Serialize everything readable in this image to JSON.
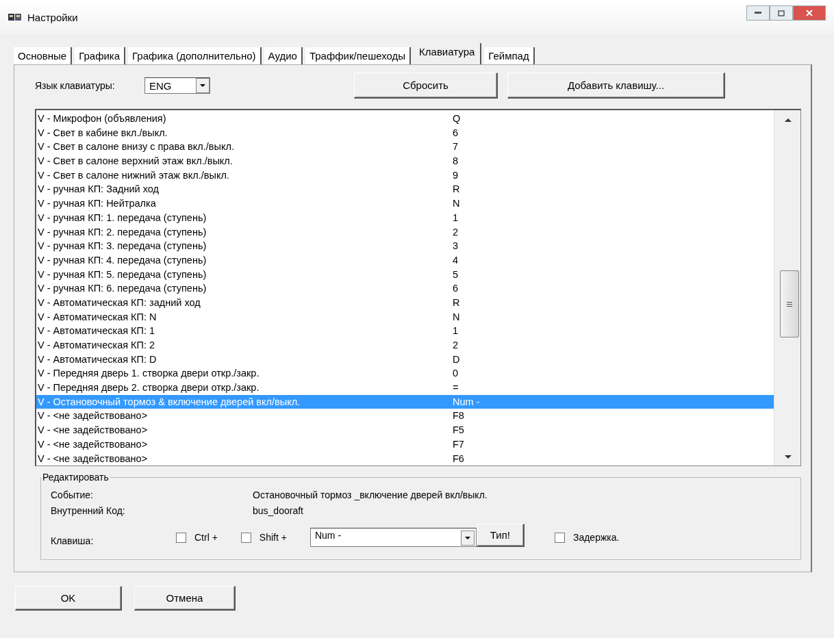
{
  "window": {
    "title": "Настройки"
  },
  "tabs": [
    {
      "label": "Основные",
      "selected": false
    },
    {
      "label": "Графика",
      "selected": false
    },
    {
      "label": "Графика (дополнительно)",
      "selected": false
    },
    {
      "label": "Аудио",
      "selected": false
    },
    {
      "label": "Траффик/пешеходы",
      "selected": false
    },
    {
      "label": "Клавиатура",
      "selected": true
    },
    {
      "label": "Геймпад",
      "selected": false
    }
  ],
  "keyboard_language": {
    "label": "Язык клавиатуры:",
    "value": "ENG"
  },
  "top_buttons": [
    "Сбросить",
    "Добавить клавишу..."
  ],
  "bindings": [
    {
      "action": "V - Микрофон (объявления)",
      "key": "Q",
      "selected": false
    },
    {
      "action": "V - Свет в кабине вкл./выкл.",
      "key": "6",
      "selected": false
    },
    {
      "action": "V - Свет в салоне внизу с права вкл./выкл.",
      "key": "7",
      "selected": false
    },
    {
      "action": "V - Свет в салоне верхний этаж вкл./выкл.",
      "key": "8",
      "selected": false
    },
    {
      "action": "V - Свет в салоне нижний этаж вкл./выкл.",
      "key": "9",
      "selected": false
    },
    {
      "action": "V - ручная КП: Задний ход",
      "key": "R",
      "selected": false
    },
    {
      "action": "V - ручная КП: Нейтралка",
      "key": "N",
      "selected": false
    },
    {
      "action": "V - ручная КП: 1. передача (ступень)",
      "key": "1",
      "selected": false
    },
    {
      "action": "V - ручная КП: 2. передача (ступень)",
      "key": "2",
      "selected": false
    },
    {
      "action": "V - ручная КП: 3. передача (ступень)",
      "key": "3",
      "selected": false
    },
    {
      "action": "V - ручная КП: 4. передача (ступень)",
      "key": "4",
      "selected": false
    },
    {
      "action": "V - ручная КП: 5. передача (ступень)",
      "key": "5",
      "selected": false
    },
    {
      "action": "V - ручная КП: 6. передача (ступень)",
      "key": "6",
      "selected": false
    },
    {
      "action": "V - Автоматическая КП: задний ход",
      "key": "R",
      "selected": false
    },
    {
      "action": "V - Автоматическая КП: N",
      "key": "N",
      "selected": false
    },
    {
      "action": "V - Автоматическая КП: 1",
      "key": "1",
      "selected": false
    },
    {
      "action": "V - Автоматическая КП: 2",
      "key": "2",
      "selected": false
    },
    {
      "action": "V - Автоматическая КП: D",
      "key": "D",
      "selected": false
    },
    {
      "action": "V - Передняя дверь 1. створка двери откр./закр.",
      "key": "0",
      "selected": false
    },
    {
      "action": "V - Передняя дверь 2. створка двери откр./закр.",
      "key": "=",
      "selected": false
    },
    {
      "action": "V - Остановочный тормоз & включение дверей вкл/выкл.",
      "key": "Num -",
      "selected": true
    },
    {
      "action": "V - <не задействовано>",
      "key": "F8",
      "selected": false
    },
    {
      "action": "V - <не задействовано>",
      "key": "F5",
      "selected": false
    },
    {
      "action": "V - <не задействовано>",
      "key": "F7",
      "selected": false
    },
    {
      "action": "V - <не задействовано>",
      "key": "F6",
      "selected": false
    }
  ],
  "edit": {
    "title": "Редактировать",
    "event_label": "Событие:",
    "event_value": "Остановочный тормоз _включение дверей вкл/выкл.",
    "code_label": "Внутренний Код:",
    "code_value": "bus_dooraft",
    "key_label": "Клавиша:",
    "ctrl": {
      "label": "Ctrl +",
      "checked": false
    },
    "shift": {
      "label": "Shift +",
      "checked": false
    },
    "key_value": "Num -",
    "type_button": "Тип!",
    "delay": {
      "label": "Задержка.",
      "checked": false
    }
  },
  "buttons": [
    "OK",
    "Отмена"
  ]
}
